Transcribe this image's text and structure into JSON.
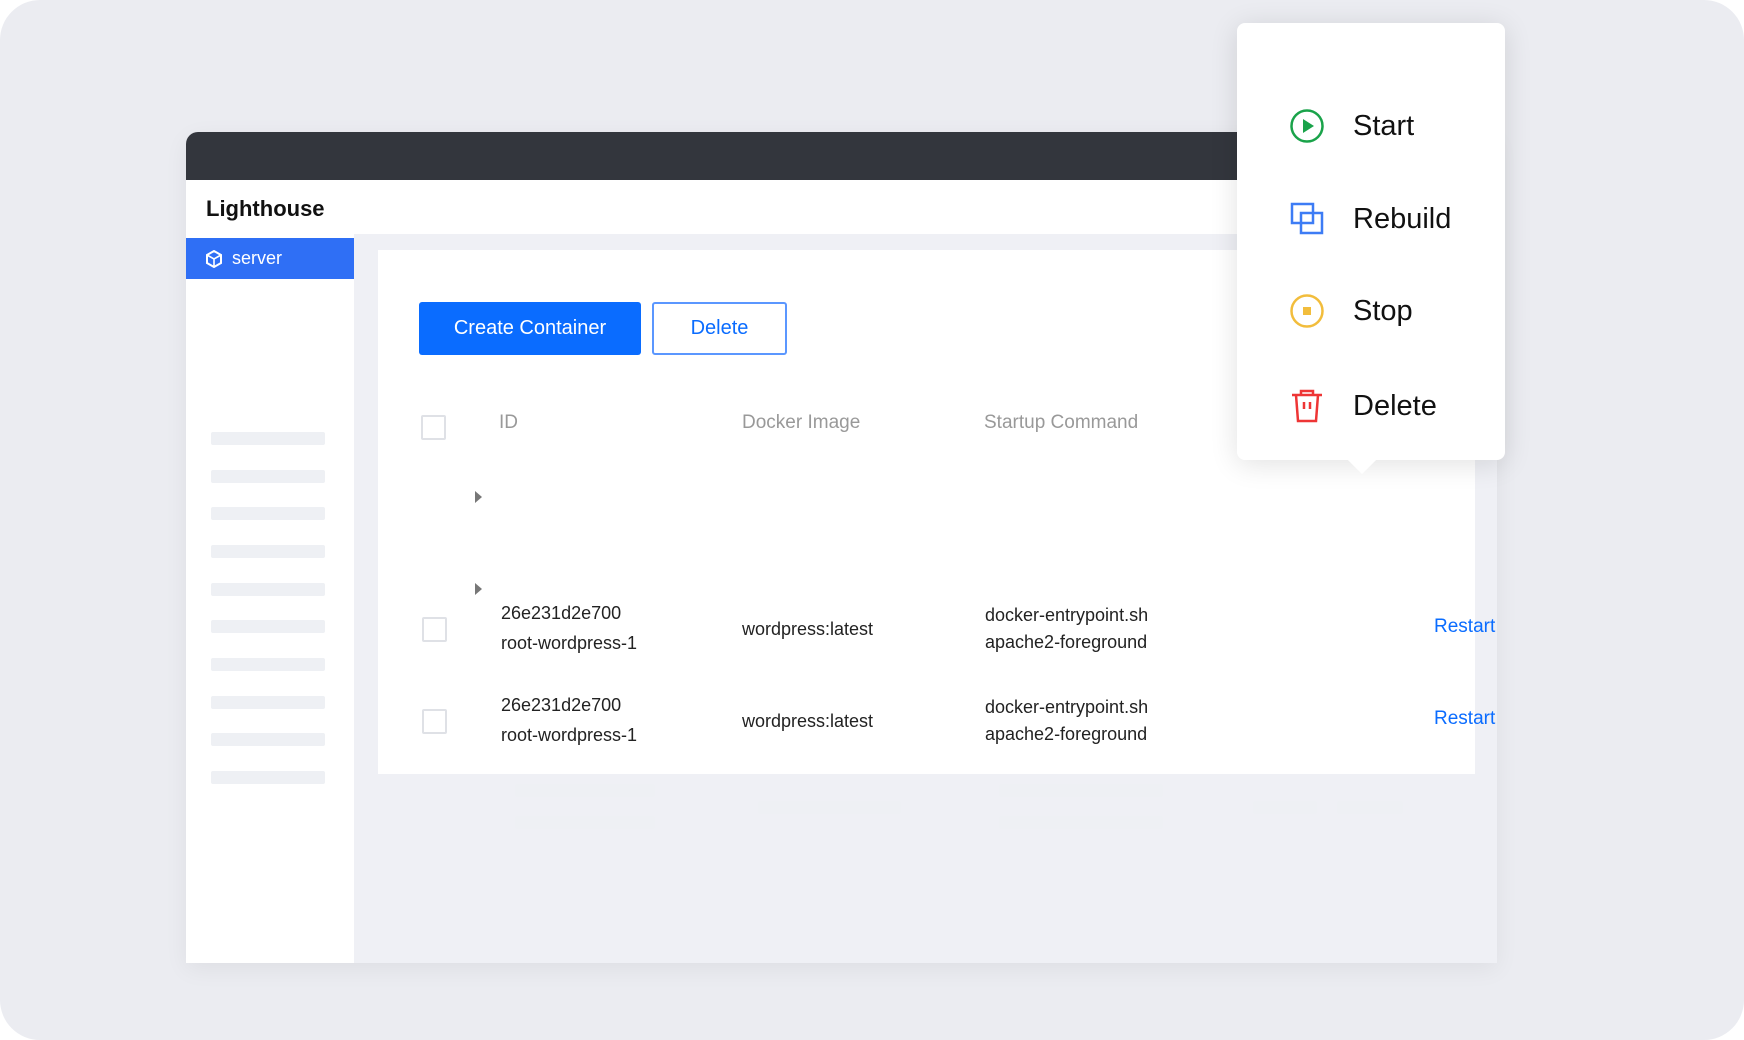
{
  "app": {
    "title": "Lighthouse"
  },
  "sidebar": {
    "active_item": "server"
  },
  "toolbar": {
    "create_label": "Create Container",
    "delete_label": "Delete"
  },
  "table": {
    "headers": [
      "ID",
      "Docker Image",
      "Startup Command"
    ],
    "rows": [
      {
        "id": "26e231d2e700",
        "name": "root-wordpress-1",
        "image": "wordpress:latest",
        "cmd1": "docker-entrypoint.sh",
        "cmd2": "apache2-foreground",
        "restart": "Restart",
        "more": "more"
      },
      {
        "id": "26e231d2e700",
        "name": "root-wordpress-1",
        "image": "wordpress:latest",
        "cmd1": "docker-entrypoint.sh",
        "cmd2": "apache2-foreground",
        "restart": "Restart",
        "more": "more"
      }
    ]
  },
  "menu": {
    "items": [
      {
        "label": "Start",
        "icon": "play-circle-icon",
        "color": "#1aa34a"
      },
      {
        "label": "Rebuild",
        "icon": "rebuild-icon",
        "color": "#3d7cf5"
      },
      {
        "label": "Stop",
        "icon": "stop-circle-icon",
        "color": "#f2bd3c"
      },
      {
        "label": "Delete",
        "icon": "trash-icon",
        "color": "#ee3535"
      }
    ]
  },
  "colors": {
    "primary": "#0a6cff",
    "topbar": "#33363d",
    "sidebar_active": "#2f6ff5"
  }
}
